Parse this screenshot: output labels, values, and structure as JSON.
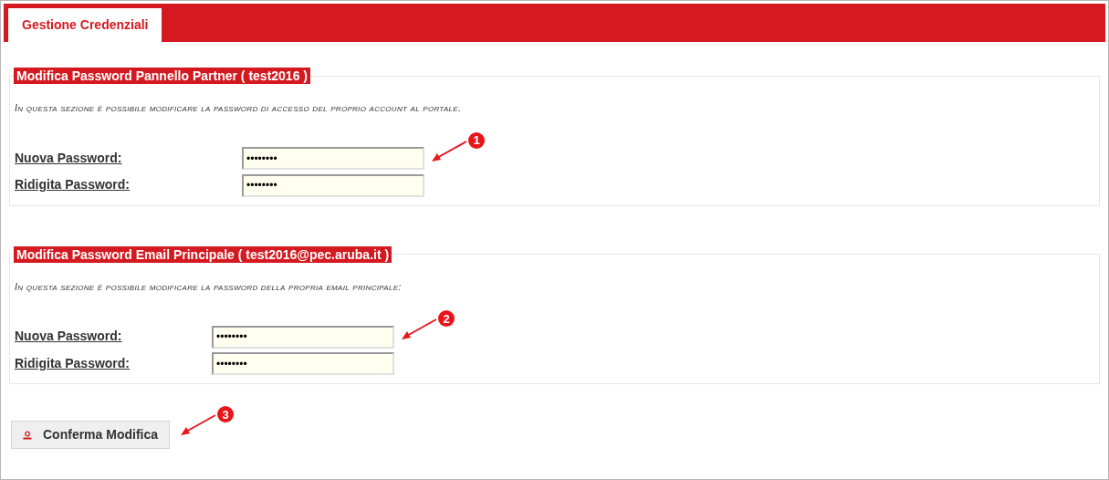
{
  "tab": {
    "label": "Gestione Credenziali",
    "selected": true
  },
  "sections": [
    {
      "title": "Modifica Password Pannello Partner ( test2016 )",
      "description": "In questa sezione è possibile modificare la password di accesso del proprio account al portale.",
      "fields": [
        {
          "label": "Nuova Password:",
          "value": "••••••••"
        },
        {
          "label": "Ridigita Password:",
          "value": "••••••••"
        }
      ],
      "callout": "1"
    },
    {
      "title": "Modifica Password Email Principale ( test2016@pec.aruba.it )",
      "description": "In questa sezione è possibile modificare la password della propria email principale:",
      "fields": [
        {
          "label": "Nuova Password:",
          "value": "••••••••"
        },
        {
          "label": "Ridigita Password:",
          "value": "••••••••"
        }
      ],
      "callout": "2"
    }
  ],
  "button": {
    "label": "Conferma Modifica",
    "callout": "3"
  }
}
